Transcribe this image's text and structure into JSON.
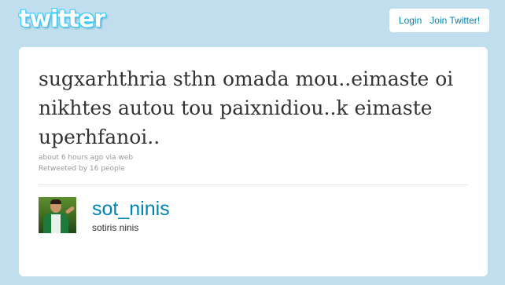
{
  "header": {
    "logo_text": "twitter",
    "login_label": "Login",
    "join_label": "Join Twitter!"
  },
  "tweet": {
    "text": "sugxarhthria sthn omada mou..eimaste oi nikhtes autou tou paixnidiou..k eimaste uperhfanoi..",
    "time": "about 6 hours ago",
    "via_prefix": "via",
    "source": "web",
    "retweet_text": "Retweeted by 16 people"
  },
  "author": {
    "screen_name": "sot_ninis",
    "full_name": "sotiris ninis"
  },
  "colors": {
    "background": "#c0deed",
    "link": "#0084b4",
    "logo": "#33ccff"
  }
}
